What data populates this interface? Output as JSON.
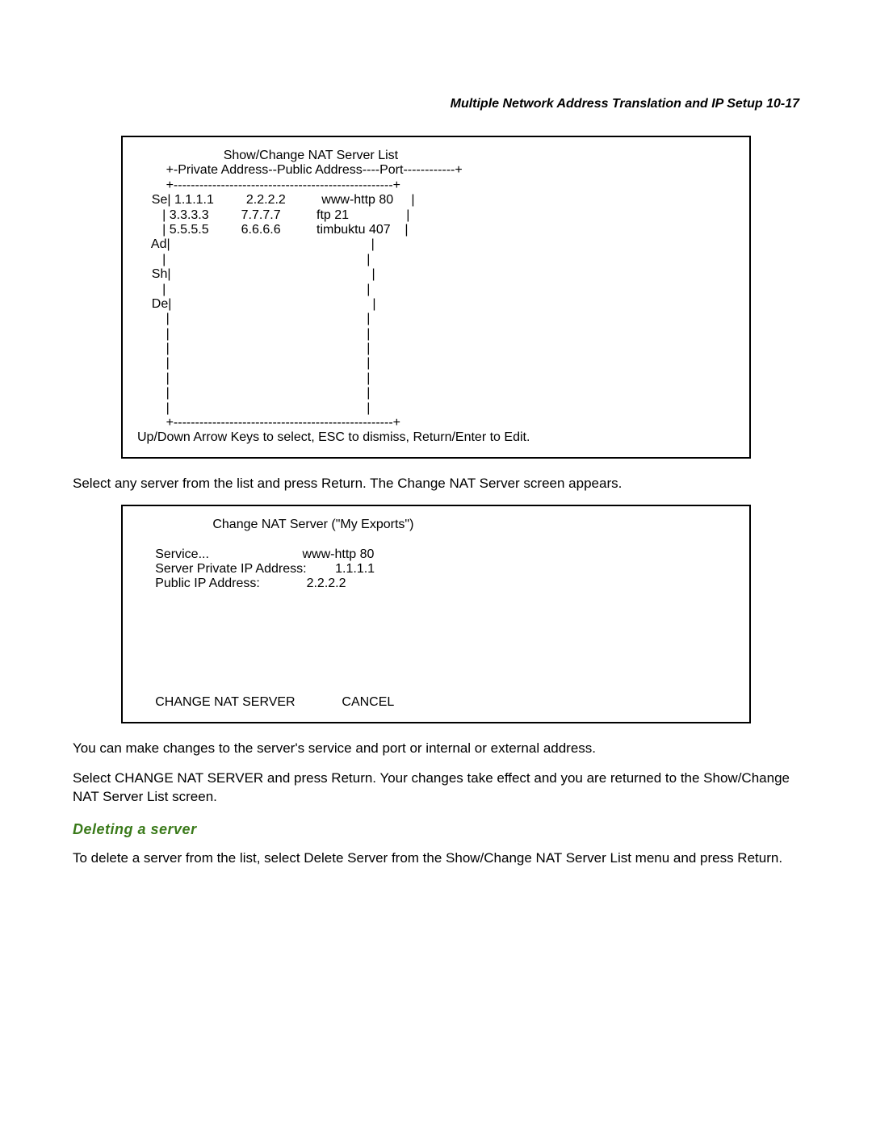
{
  "header": {
    "running_title": "Multiple Network Address Translation and IP Setup   10-17"
  },
  "box1": {
    "content": "                        Show/Change NAT Server List\n        +-Private Address--Public Address----Port------------+\n        +---------------------------------------------------+\n    Se| 1.1.1.1         2.2.2.2          www-http 80     |\n       | 3.3.3.3         7.7.7.7          ftp 21                |\n       | 5.5.5.5         6.6.6.6          timbuktu 407    |\n    Ad|                                                        |\n       |                                                        |\n    Sh|                                                        |\n       |                                                        |\n    De|                                                        |\n        |                                                       |\n        |                                                       |\n        |                                                       |\n        |                                                       |\n        |                                                       |\n        |                                                       |\n        |                                                       |\n        +---------------------------------------------------+\nUp/Down Arrow Keys to select, ESC to dismiss, Return/Enter to Edit."
  },
  "para1": "Select any server from the list and press Return. The Change NAT Server screen appears.",
  "box2": {
    "content": "                     Change NAT Server (\"My Exports\")\n\n     Service...                          www-http 80\n     Server Private IP Address:        1.1.1.1\n     Public IP Address:             2.2.2.2\n\n\n\n\n\n\n\n     CHANGE NAT SERVER             CANCEL\n"
  },
  "para2": "You can make changes to the server's service and port or internal or external address.",
  "para3": "Select CHANGE NAT SERVER and press Return. Your changes take effect and you are returned to the Show/Change NAT Server List screen.",
  "subheading": "Deleting a server",
  "para4": "To delete a server from the list, select Delete Server from the Show/Change NAT Server List menu and press Return."
}
